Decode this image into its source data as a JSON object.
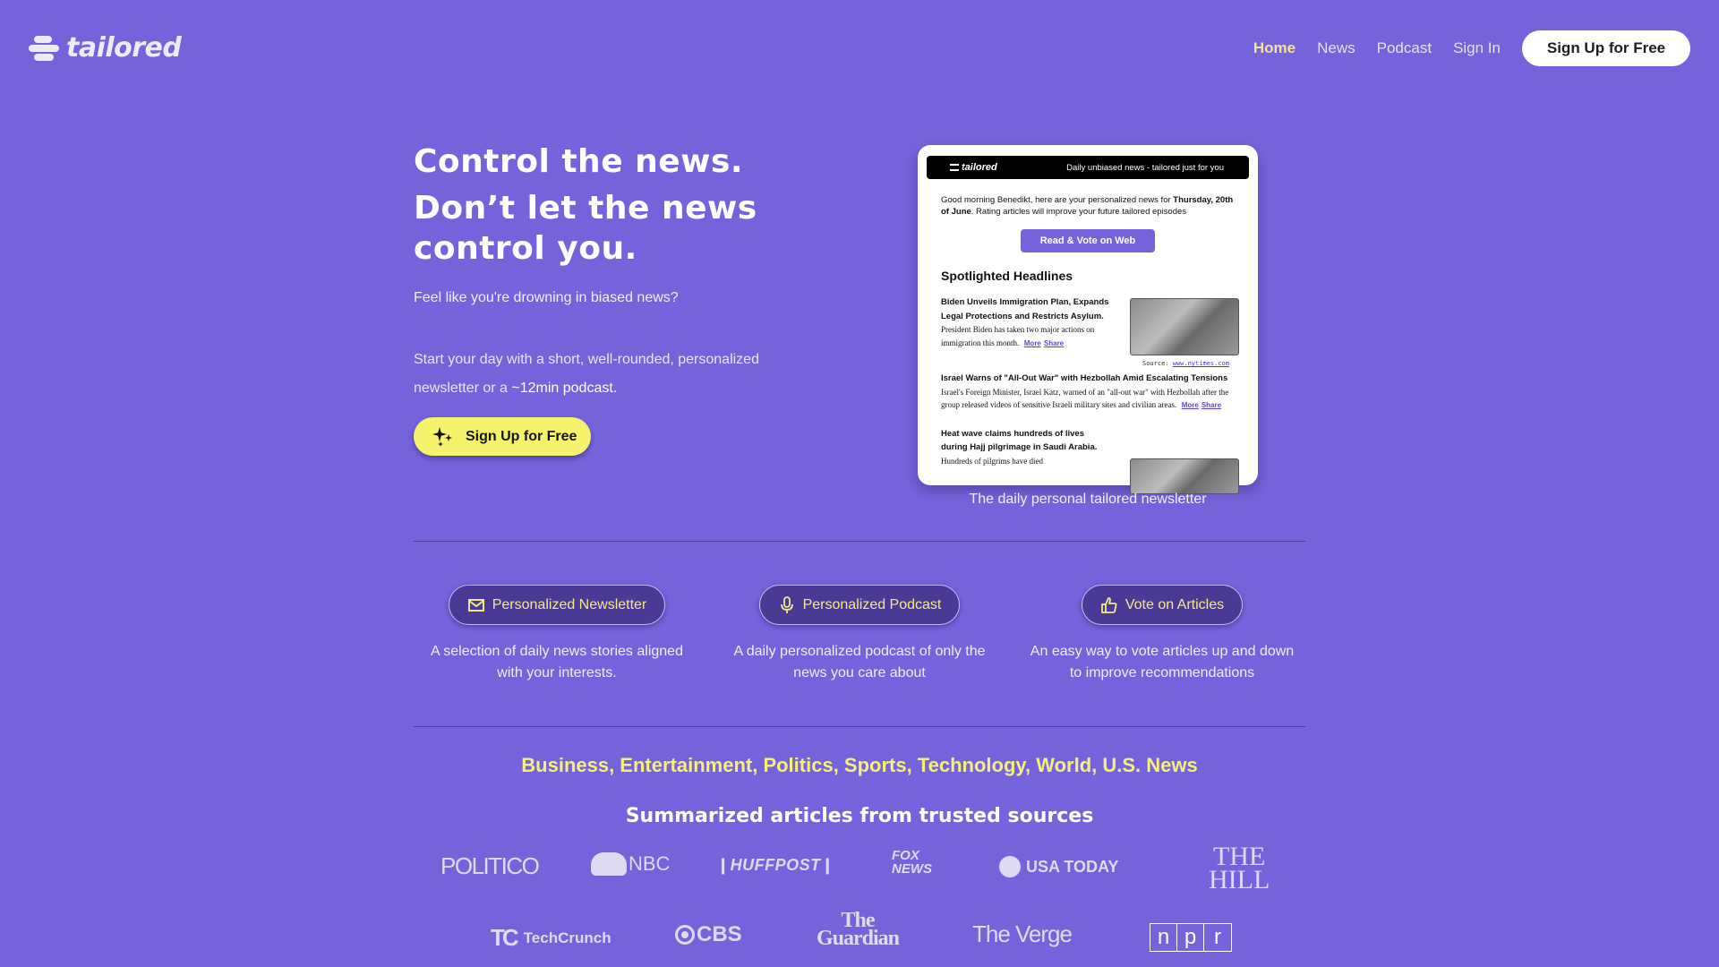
{
  "brand": {
    "name": "tailored"
  },
  "nav": {
    "links": [
      {
        "label": "Home",
        "active": true
      },
      {
        "label": "News",
        "active": false
      },
      {
        "label": "Podcast",
        "active": false
      },
      {
        "label": "Sign In",
        "active": false
      }
    ],
    "cta": "Sign Up for Free"
  },
  "hero": {
    "title_line1": "Control the news.",
    "title_line2": "Don’t let the news",
    "title_line3": "control you.",
    "subtitle": "Feel like you're drowning in biased news?",
    "description_prefix": "Start your day with a short, well-rounded, personalized newsletter or a ",
    "description_highlight": "~12min podcast.",
    "cta": "Sign Up for Free"
  },
  "preview": {
    "brand": "tailored",
    "tagline": "Daily unbiased news - tailored just for you",
    "greeting_prefix": "Good morning Benedikt, here are your personalized news for ",
    "greeting_date": "Thursday, 20th of June",
    "greeting_suffix": ". Rating articles will improve your future tailored episodes",
    "button": "Read & Vote on Web",
    "section_title": "Spotlighted Headlines",
    "articles": [
      {
        "headline": "Biden Unveils Immigration Plan, Expands Legal Protections and Restricts Asylum.",
        "body": " President Biden has taken two major actions on immigration this month.",
        "more": "More",
        "share": "Share",
        "source_label": "Source:",
        "source_url": "www.nytimes.com"
      },
      {
        "headline": "Israel Warns of \"All-Out War\" with Hezbollah Amid Escalating Tensions",
        "body": " Israel's Foreign Minister, Israel Katz, warned of an \"all-out war\" with Hezbollah after the group released videos of sensitive Israeli military sites and civilian areas.",
        "more": "More",
        "share": "Share"
      },
      {
        "headline": "Heat wave claims hundreds of lives during Hajj pilgrimage in Saudi Arabia.",
        "body": " Hundreds of pilgrims have died"
      }
    ],
    "caption": "The daily personal tailored newsletter"
  },
  "features": [
    {
      "icon": "envelope-icon",
      "label": "Personalized Newsletter",
      "description": "A selection of daily news stories aligned with your interests."
    },
    {
      "icon": "microphone-icon",
      "label": "Personalized Podcast",
      "description": "A daily personalized podcast of only the news you care about"
    },
    {
      "icon": "thumbs-up-icon",
      "label": "Vote on Articles",
      "description": "An easy way to vote articles up and down to improve recommendations"
    }
  ],
  "categories": "Business, Entertainment, Politics, Sports, Technology, World, U.S. News",
  "sources": {
    "title": "Summarized articles from trusted sources",
    "logos": {
      "politico": "POLITICO",
      "nbc": "NBC",
      "huffpost": "HUFFPOST",
      "fox_line1": "FOX",
      "fox_line2": "NEWS",
      "usatoday": "USA TODAY",
      "thehill_line1": "THE",
      "thehill_line2": "HILL",
      "techcrunch_mark": "TC",
      "techcrunch": "TechCrunch",
      "cbs": "CBS",
      "guardian_line1": "The",
      "guardian_line2": "Guardian",
      "verge": "The Verge",
      "npr": [
        "n",
        "p",
        "r"
      ]
    }
  },
  "colors": {
    "background": "#7563db",
    "accent_yellow": "#f6f26c",
    "nav_active": "#f4e39a",
    "pill_bg": "#4a3a96"
  }
}
